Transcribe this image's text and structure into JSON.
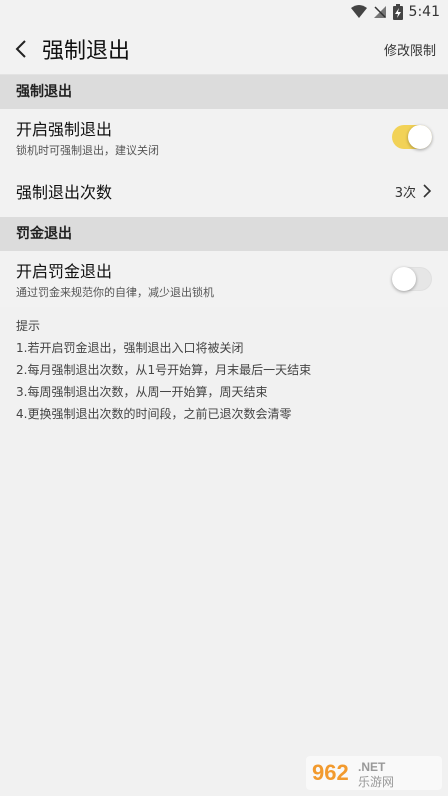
{
  "status_bar": {
    "time": "5:41"
  },
  "app_bar": {
    "title": "强制退出",
    "action": "修改限制"
  },
  "section1": {
    "header": "强制退出",
    "toggle_row": {
      "title": "开启强制退出",
      "subtitle": "锁机时可强制退出，建议关闭",
      "on": true
    },
    "count_row": {
      "title": "强制退出次数",
      "value": "3次"
    }
  },
  "section2": {
    "header": "罚金退出",
    "toggle_row": {
      "title": "开启罚金退出",
      "subtitle": "通过罚金来规范你的自律，减少退出锁机",
      "on": false
    }
  },
  "tips": {
    "title": "提示",
    "items": [
      "1.若开启罚金退出，强制退出入口将被关闭",
      "2.每月强制退出次数，从1号开始算，月末最后一天结束",
      "3.每周强制退出次数，从周一开始算，周天结束",
      "4.更换强制退出次数的时间段，之前已退次数会清零"
    ]
  },
  "colors": {
    "toggle_on": "#f2d257",
    "toggle_off": "#e6e6e6",
    "section_bg": "#dcdcdc"
  },
  "watermark": {
    "text": "962.NET 乐游网"
  }
}
